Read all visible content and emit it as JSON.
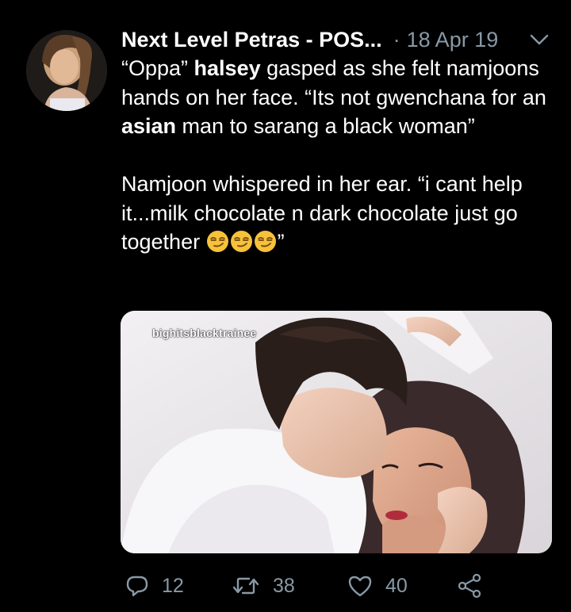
{
  "tweet": {
    "display_name": "Next Level Petras - POS...",
    "separator": "·",
    "date": "18 Apr 19",
    "body": {
      "p1": {
        "t1": "“Oppa” ",
        "b1": "halsey",
        "t2": " gasped as she felt namjoons hands on her face. “Its not gwenchana for an ",
        "b2": "asian",
        "t3": " man to sarang a black woman”"
      },
      "p2": {
        "t1": "Namjoon whispered in her ear. “i cant help it...milk chocolate n dark chocolate just go together ",
        "t2": "”"
      }
    },
    "emojis": [
      "smirking-face-emoji",
      "smirking-face-emoji",
      "smirking-face-emoji"
    ],
    "media": {
      "watermark": "bighitsblacktrainee"
    },
    "actions": {
      "replies": "12",
      "retweets": "38",
      "likes": "40"
    }
  },
  "colors": {
    "background": "#000000",
    "text": "#ffffff",
    "secondary": "#8899a6",
    "emoji": "#f7c23a"
  }
}
